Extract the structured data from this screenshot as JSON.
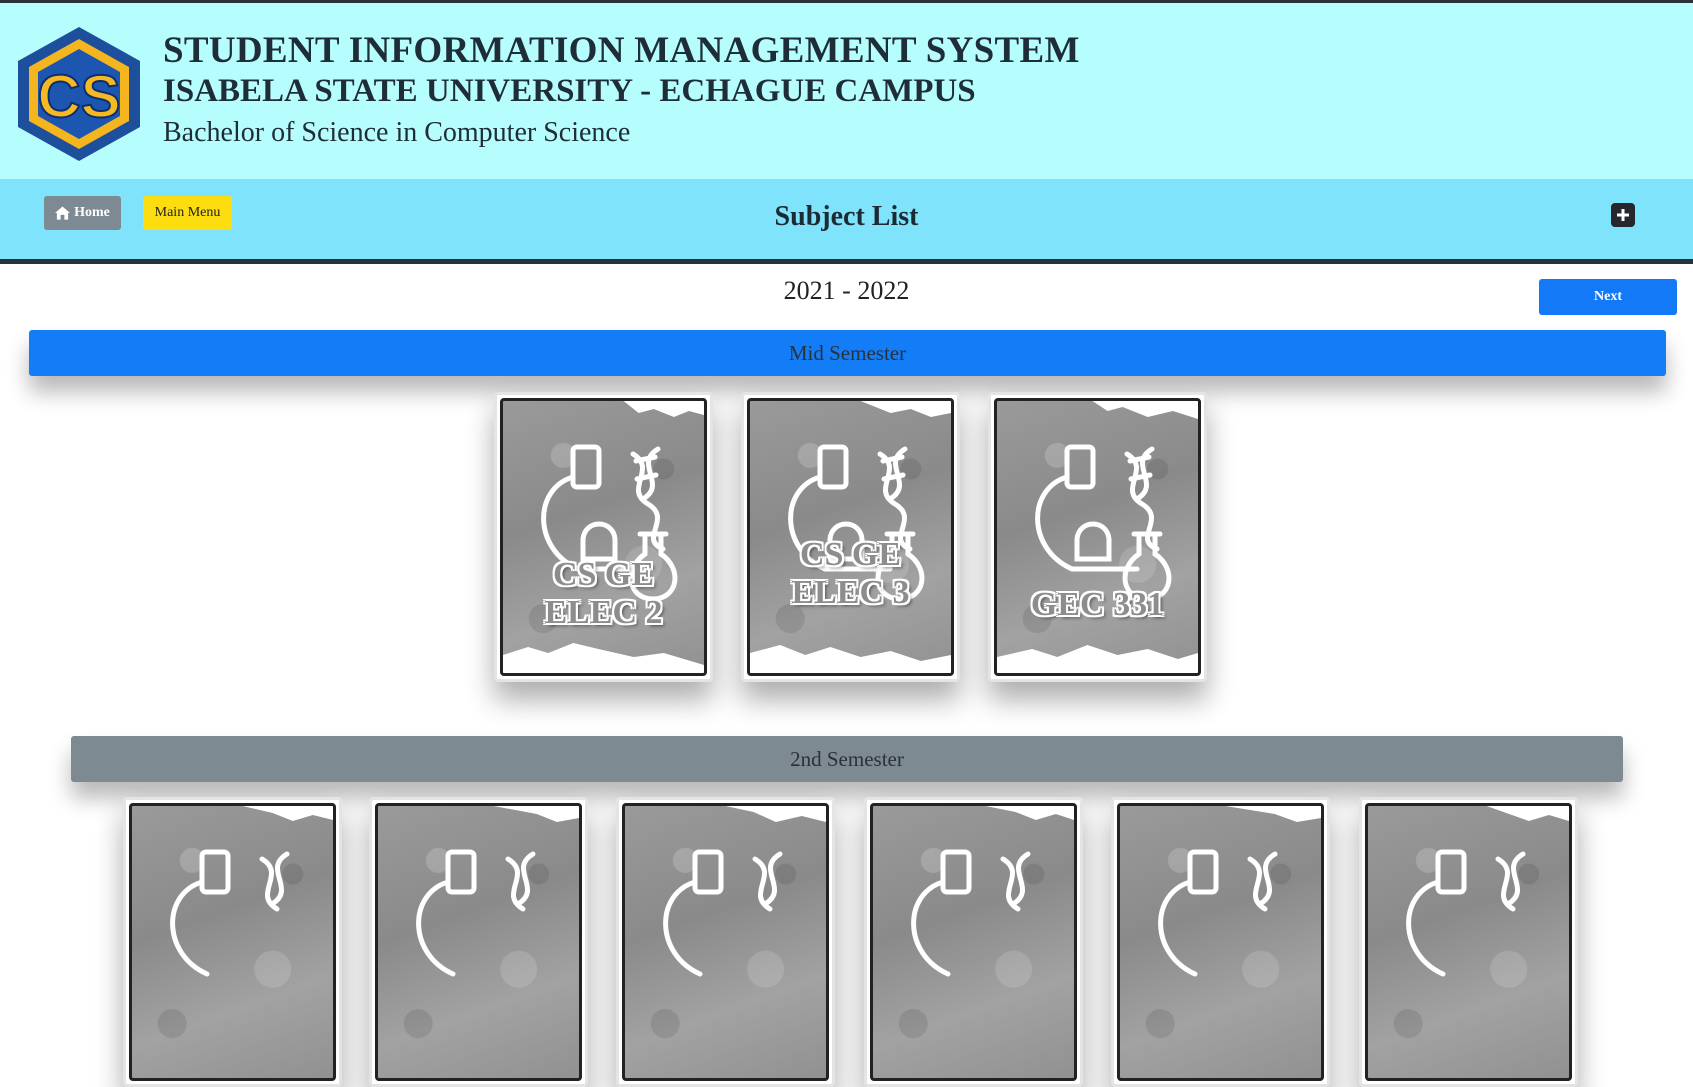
{
  "header": {
    "title": "STUDENT INFORMATION MANAGEMENT SYSTEM",
    "university": "ISABELA STATE UNIVERSITY - ECHAGUE CAMPUS",
    "program": "Bachelor of Science in Computer Science",
    "logo_text": "CS"
  },
  "nav": {
    "home_label": "Home",
    "main_menu_label": "Main Menu",
    "page_title": "Subject List",
    "add_icon": "plus-square-icon"
  },
  "school_year": "2021 - 2022",
  "next_label": "Next",
  "semesters": [
    {
      "label": "Mid Semester",
      "color": "#137cf7",
      "subjects": [
        {
          "line1": "CS GE",
          "line2": "ELEC 2"
        },
        {
          "line1": "CS GE",
          "line2": "ELEC 3"
        },
        {
          "line1": "GEC 331",
          "line2": ""
        }
      ]
    },
    {
      "label": "2nd Semester",
      "color": "#7e8a92"
    }
  ],
  "colors": {
    "header_bg": "#b6fdfd",
    "nav_bg": "#7ee3fb",
    "home_button": "#7d8a93",
    "main_menu_button": "#fcde10",
    "next_button": "#1379f7"
  }
}
